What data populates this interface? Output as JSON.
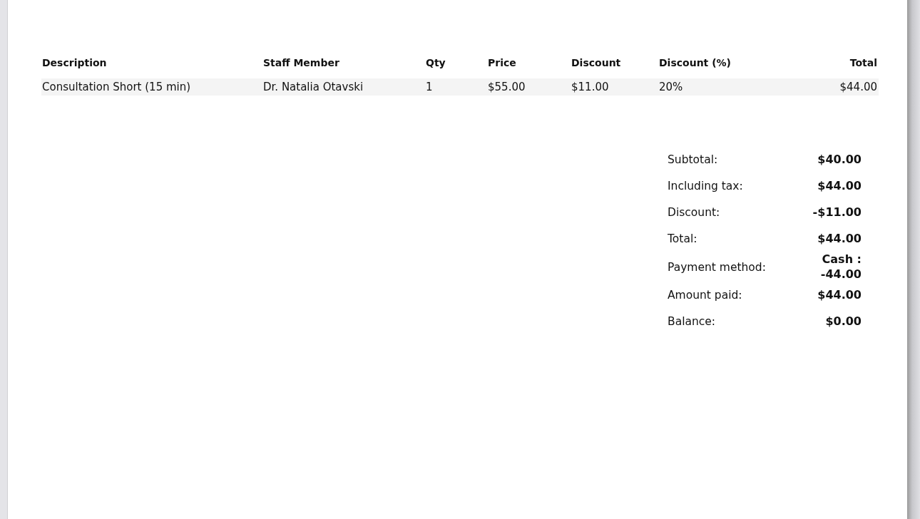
{
  "table": {
    "columns": [
      "Description",
      "Staff Member",
      "Qty",
      "Price",
      "Discount",
      "Discount (%)",
      "Total"
    ],
    "rows": [
      [
        "Consultation Short (15 min)",
        "Dr. Natalia Otavski",
        "1",
        "$55.00",
        "$11.00",
        "20%",
        "$44.00"
      ]
    ]
  },
  "summary": [
    {
      "label": "Subtotal:",
      "value": "$40.00"
    },
    {
      "label": "Including tax:",
      "value": "$44.00"
    },
    {
      "label": "Discount:",
      "value": "-$11.00"
    },
    {
      "label": "Total:",
      "value": "$44.00"
    },
    {
      "label": "Payment method:",
      "value": "Cash : -44.00"
    },
    {
      "label": "Amount paid:",
      "value": "$44.00"
    },
    {
      "label": "Balance:",
      "value": "$0.00"
    }
  ]
}
